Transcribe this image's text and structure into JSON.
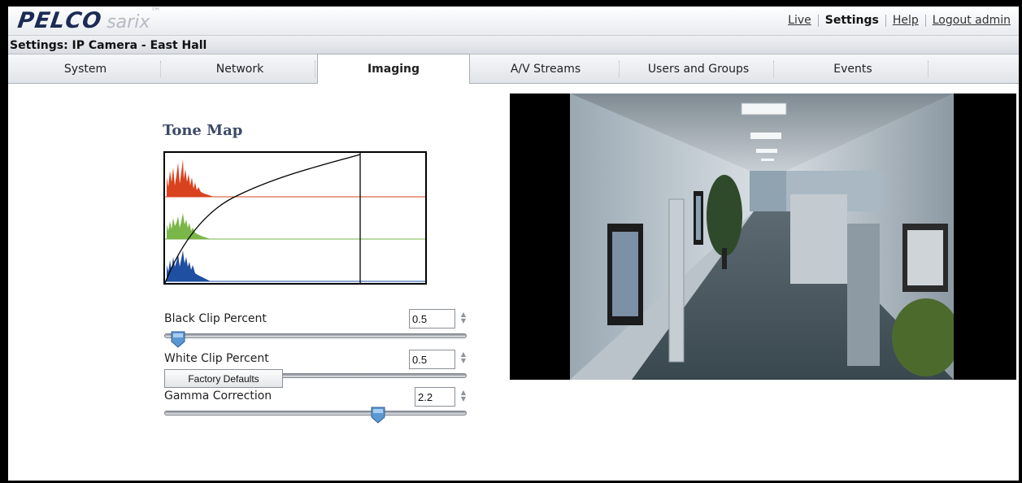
{
  "brand": {
    "name": "PELCO",
    "product": "sarix",
    "trademark": "™"
  },
  "top_nav": {
    "live": "Live",
    "settings": "Settings",
    "help": "Help",
    "logout": "Logout admin"
  },
  "title": "Settings: IP Camera - East Hall",
  "tabs": [
    {
      "label": "System"
    },
    {
      "label": "Network"
    },
    {
      "label": "Imaging",
      "active": true
    },
    {
      "label": "A/V Streams"
    },
    {
      "label": "Users and Groups"
    },
    {
      "label": "Events"
    }
  ],
  "tone_map": {
    "title": "Tone Map",
    "histogram_colors": {
      "red": "#d9421e",
      "green": "#7ab648",
      "blue": "#1e4fa0"
    }
  },
  "controls": {
    "black_clip": {
      "label": "Black Clip Percent",
      "value": "0.5",
      "slider_fraction": 0.05
    },
    "white_clip": {
      "label": "White Clip Percent",
      "value": "0.5",
      "slider_fraction": 0.05
    },
    "gamma": {
      "label": "Gamma Correction",
      "value": "2.2",
      "slider_fraction": 0.7
    }
  },
  "buttons": {
    "factory_defaults": "Factory Defaults"
  },
  "colors": {
    "brand_navy": "#1b2b55",
    "title_text": "#3c4a66"
  }
}
